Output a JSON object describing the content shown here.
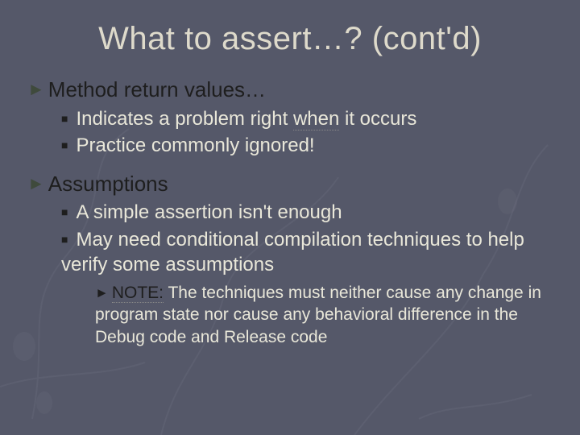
{
  "title": "What to assert…? (cont'd)",
  "b1": {
    "heading": "Method return values…",
    "sub": [
      {
        "pre": "Indicates a problem right ",
        "u": "when",
        "post": " it occurs"
      },
      {
        "pre": "Practice commonly ignored!",
        "u": "",
        "post": ""
      }
    ]
  },
  "b2": {
    "heading": "Assumptions",
    "sub": [
      "A simple assertion isn't enough",
      "May need conditional compilation techniques to help verify some assumptions"
    ],
    "note_label": "NOTE:",
    "note_text": " The techniques must neither cause any change in program state nor cause any behavioral difference in the Debug code and Release code"
  }
}
